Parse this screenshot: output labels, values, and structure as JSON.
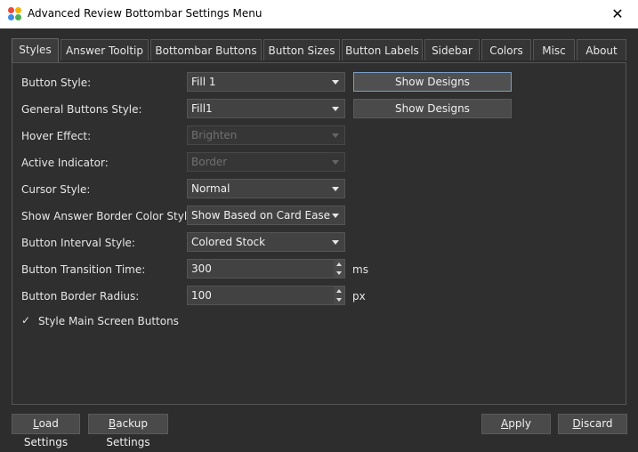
{
  "window": {
    "title": "Advanced Review Bottombar Settings Menu",
    "icon": "app-logo-icon",
    "close_icon": "✕"
  },
  "tabs": [
    {
      "label": "Styles",
      "active": true
    },
    {
      "label": "Answer Tooltip",
      "active": false
    },
    {
      "label": "Bottombar Buttons",
      "active": false
    },
    {
      "label": "Button Sizes",
      "active": false
    },
    {
      "label": "Button Labels",
      "active": false
    },
    {
      "label": "Sidebar",
      "active": false
    },
    {
      "label": "Colors",
      "active": false
    },
    {
      "label": "Misc",
      "active": false
    },
    {
      "label": "About",
      "active": false
    }
  ],
  "settings": {
    "button_style": {
      "label": "Button Style:",
      "value": "Fill 1",
      "button": "Show Designs"
    },
    "general_buttons_style": {
      "label": "General Buttons Style:",
      "value": "Fill1",
      "button": "Show Designs"
    },
    "hover_effect": {
      "label": "Hover Effect:",
      "value": "Brighten",
      "disabled": true
    },
    "active_indicator": {
      "label": "Active Indicator:",
      "value": "Border",
      "disabled": true
    },
    "cursor_style": {
      "label": "Cursor Style:",
      "value": "Normal"
    },
    "answer_border_color_style": {
      "label": "Show Answer Border Color Style:",
      "value": "Show Based on Card Ease"
    },
    "button_interval_style": {
      "label": "Button Interval Style:",
      "value": "Colored Stock"
    },
    "button_transition_time": {
      "label": "Button Transition Time:",
      "value": "300",
      "unit": "ms"
    },
    "button_border_radius": {
      "label": "Button Border Radius:",
      "value": "100",
      "unit": "px"
    },
    "style_main_screen_buttons": {
      "label": "Style Main Screen Buttons",
      "checked": true,
      "check_glyph": "✓"
    }
  },
  "footer": {
    "load_settings": {
      "underline": "L",
      "rest": "oad Settings"
    },
    "backup_settings": {
      "underline": "B",
      "rest": "ackup Settings"
    },
    "apply": {
      "underline": "A",
      "rest": "pply"
    },
    "discard": {
      "underline": "D",
      "rest": "iscard"
    }
  },
  "colors": {
    "background": "#2d2d2d",
    "titlebar": "#ffffff",
    "focus_border": "#7a9ec7"
  }
}
